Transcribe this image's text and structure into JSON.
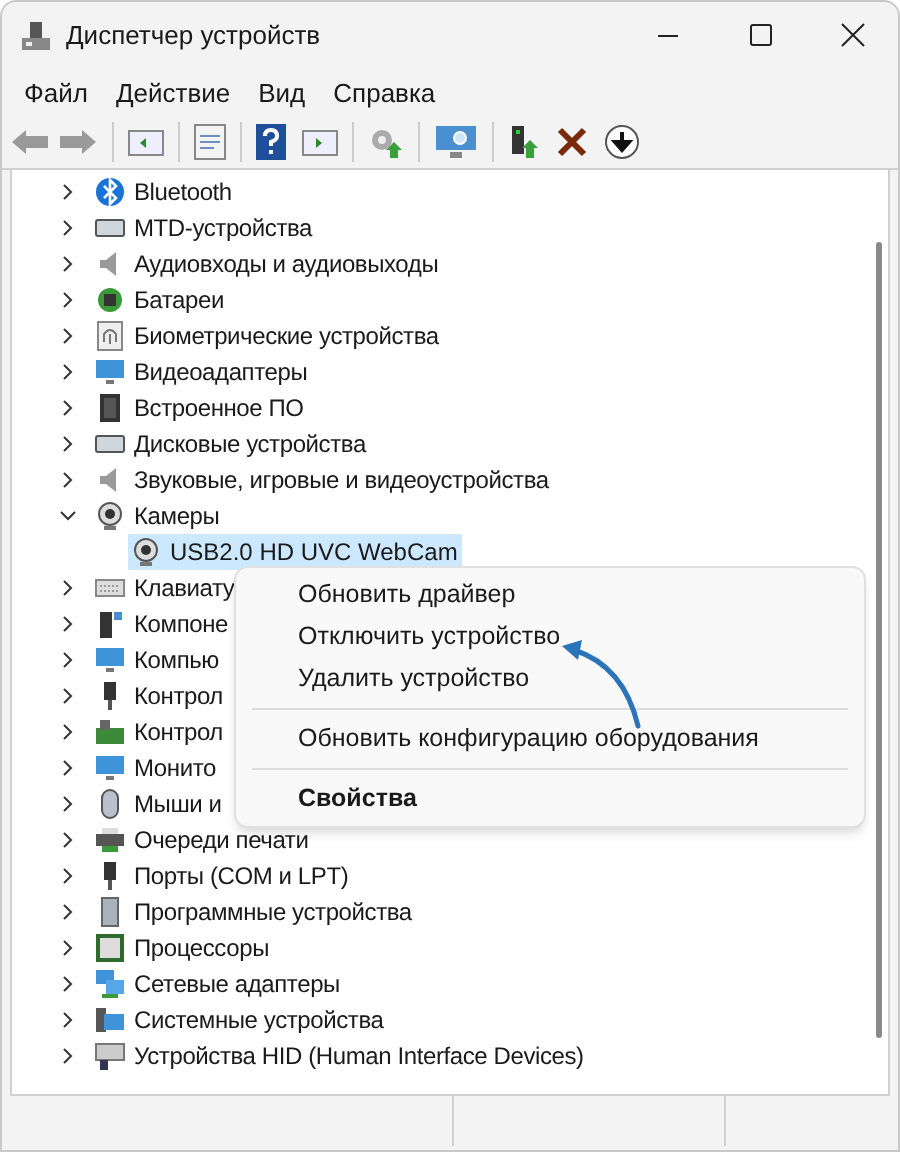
{
  "window": {
    "title": "Диспетчер устройств"
  },
  "menu": [
    "Файл",
    "Действие",
    "Вид",
    "Справка"
  ],
  "tree": {
    "items": [
      {
        "label": "Bluetooth",
        "expanded": false,
        "selected": false
      },
      {
        "label": "MTD-устройства",
        "expanded": false,
        "selected": false
      },
      {
        "label": "Аудиовходы и аудиовыходы",
        "expanded": false,
        "selected": false
      },
      {
        "label": "Батареи",
        "expanded": false,
        "selected": false
      },
      {
        "label": "Биометрические устройства",
        "expanded": false,
        "selected": false
      },
      {
        "label": "Видеоадаптеры",
        "expanded": false,
        "selected": false
      },
      {
        "label": "Встроенное ПО",
        "expanded": false,
        "selected": false
      },
      {
        "label": "Дисковые устройства",
        "expanded": false,
        "selected": false
      },
      {
        "label": "Звуковые, игровые и видеоустройства",
        "expanded": false,
        "selected": false
      },
      {
        "label": "Камеры",
        "expanded": true,
        "selected": false,
        "children": [
          {
            "label": "USB2.0 HD UVC WebCam",
            "selected": true
          }
        ]
      },
      {
        "label": "Клавиату",
        "expanded": false,
        "selected": false
      },
      {
        "label": "Компоне",
        "expanded": false,
        "selected": false
      },
      {
        "label": "Компью",
        "expanded": false,
        "selected": false
      },
      {
        "label": "Контрол",
        "expanded": false,
        "selected": false
      },
      {
        "label": "Контрол",
        "expanded": false,
        "selected": false
      },
      {
        "label": "Монито",
        "expanded": false,
        "selected": false
      },
      {
        "label": "Мыши и",
        "expanded": false,
        "selected": false
      },
      {
        "label": "Очереди печати",
        "expanded": false,
        "selected": false
      },
      {
        "label": "Порты (COM и LPT)",
        "expanded": false,
        "selected": false
      },
      {
        "label": "Программные устройства",
        "expanded": false,
        "selected": false
      },
      {
        "label": "Процессоры",
        "expanded": false,
        "selected": false
      },
      {
        "label": "Сетевые адаптеры",
        "expanded": false,
        "selected": false
      },
      {
        "label": "Системные устройства",
        "expanded": false,
        "selected": false
      },
      {
        "label": "Устройства HID (Human Interface Devices)",
        "expanded": false,
        "selected": false
      }
    ]
  },
  "context_menu": {
    "items": [
      {
        "kind": "item",
        "label": "Обновить драйвер"
      },
      {
        "kind": "item",
        "label": "Отключить устройство"
      },
      {
        "kind": "item",
        "label": "Удалить устройство"
      },
      {
        "kind": "separator"
      },
      {
        "kind": "item",
        "label": "Обновить конфигурацию оборудования"
      },
      {
        "kind": "separator"
      },
      {
        "kind": "default",
        "label": "Свойства"
      }
    ]
  }
}
